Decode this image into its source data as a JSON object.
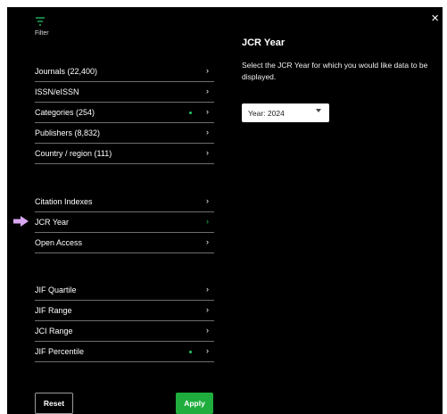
{
  "header": {
    "filter_label": "Filter",
    "close_glyph": "×",
    "accent_color": "#22c55e"
  },
  "menu_groups": [
    {
      "items": [
        {
          "label": "Journals (22,400)",
          "active": false,
          "dot": false
        },
        {
          "label": "ISSN/eISSN",
          "active": false,
          "dot": false
        },
        {
          "label": "Categories (254)",
          "active": false,
          "dot": true
        },
        {
          "label": "Publishers (8,832)",
          "active": false,
          "dot": false
        },
        {
          "label": "Country / region (111)",
          "active": false,
          "dot": false
        }
      ]
    },
    {
      "items": [
        {
          "label": "Citation Indexes",
          "active": false,
          "dot": false
        },
        {
          "label": "JCR Year",
          "active": true,
          "dot": false
        },
        {
          "label": "Open Access",
          "active": false,
          "dot": false
        }
      ]
    },
    {
      "items": [
        {
          "label": "JIF Quartile",
          "active": false,
          "dot": false
        },
        {
          "label": "JIF Range",
          "active": false,
          "dot": false
        },
        {
          "label": "JCI Range",
          "active": false,
          "dot": false
        },
        {
          "label": "JIF Percentile",
          "active": false,
          "dot": true
        }
      ]
    }
  ],
  "chevron_glyph": "›",
  "pointer_color": "#d9a6f0",
  "panel": {
    "title": "JCR Year",
    "description": "Select the JCR Year for which you would like data to be displayed.",
    "year_value": "Year: 2024"
  },
  "footer": {
    "reset_label": "Reset",
    "apply_label": "Apply",
    "apply_color": "#1fae3e"
  }
}
